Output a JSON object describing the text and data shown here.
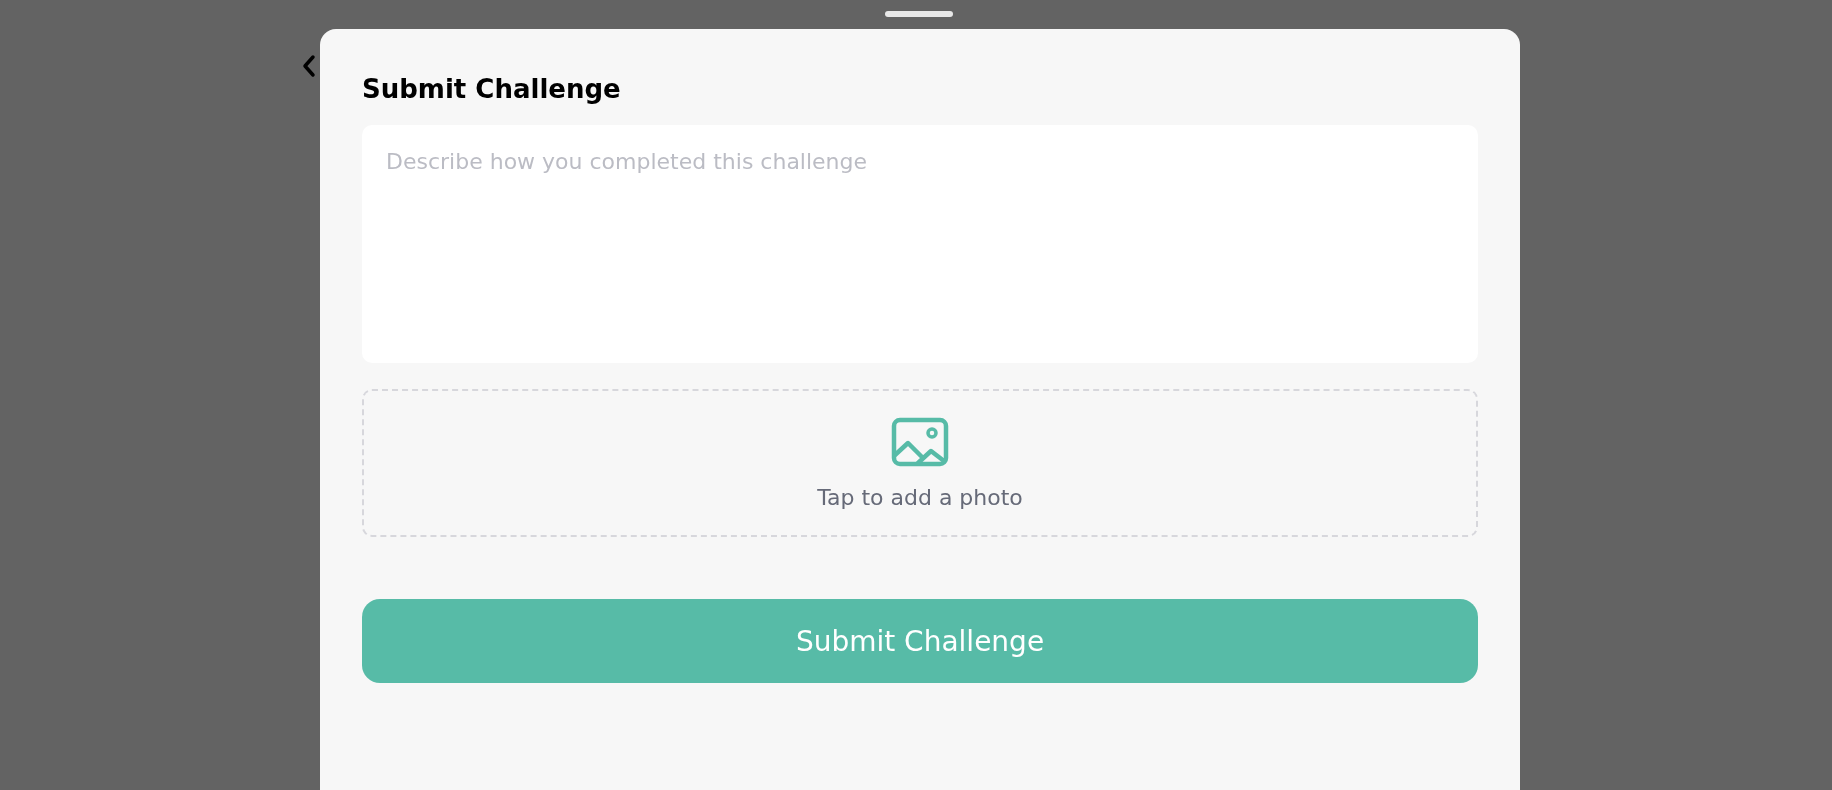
{
  "sheet": {
    "title": "Submit Challenge"
  },
  "description": {
    "placeholder": "Describe how you completed this challenge"
  },
  "photo_upload": {
    "label": "Tap to add a photo"
  },
  "submit_button": {
    "label": "Submit Challenge"
  }
}
